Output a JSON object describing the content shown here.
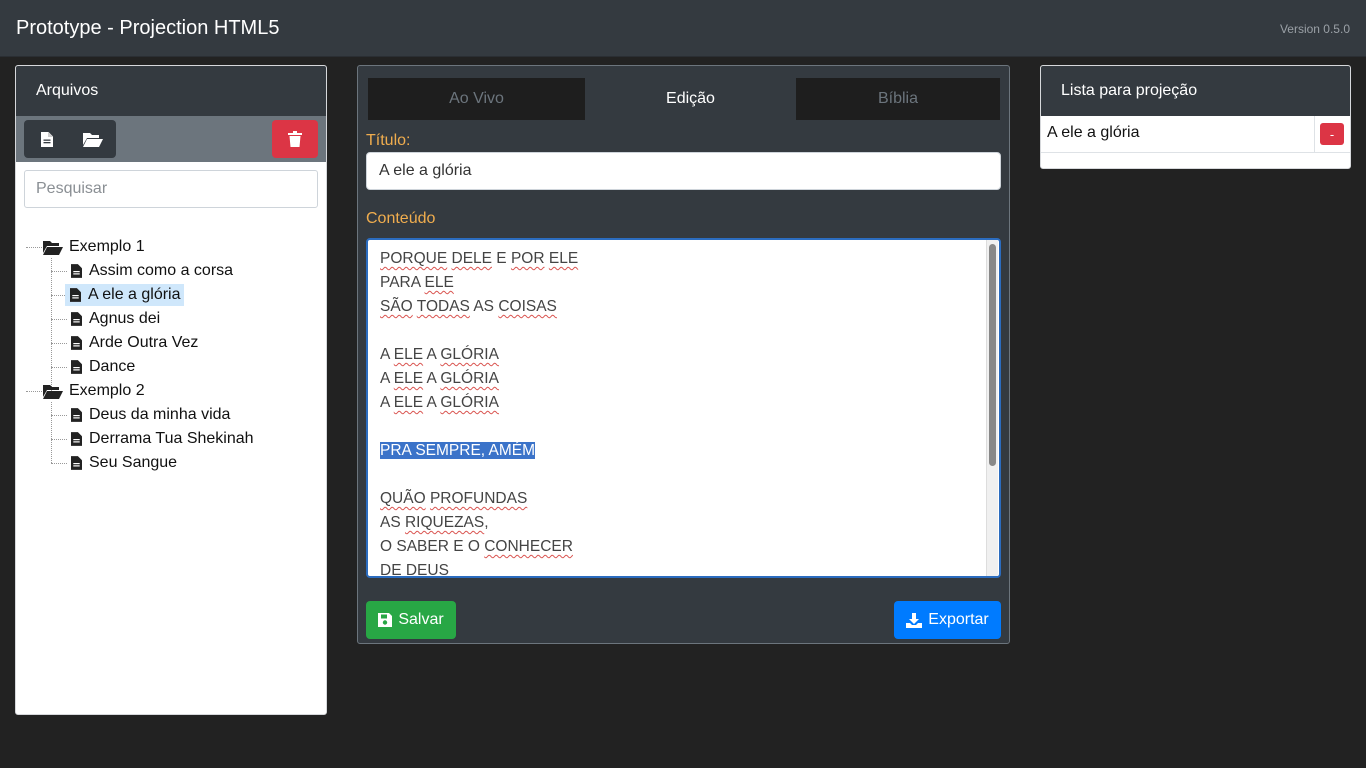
{
  "app": {
    "title": "Prototype - Projection HTML5",
    "version": "Version 0.5.0"
  },
  "files_panel": {
    "header": "Arquivos",
    "toolbar": {
      "new_icon": "file-icon",
      "open_icon": "folder-open-icon",
      "delete_icon": "trash-icon"
    },
    "search_placeholder": "Pesquisar",
    "tree": [
      {
        "label": "Exemplo 1",
        "icon": "folder-open-icon",
        "children": [
          "Assim como a corsa",
          "A ele a glória",
          "Agnus dei",
          "Arde Outra Vez",
          "Dance"
        ]
      },
      {
        "label": "Exemplo 2",
        "icon": "folder-open-icon",
        "children": [
          "Deus da minha vida",
          "Derrama Tua Shekinah",
          "Seu Sangue"
        ]
      }
    ],
    "selected_item": "A ele a glória"
  },
  "editor": {
    "tabs": [
      "Ao Vivo",
      "Edição",
      "Bíblia"
    ],
    "active_tab": "Edição",
    "title_label": "Título:",
    "title_value": "A ele a glória",
    "content_label": "Conteúdo",
    "content_lines": [
      "PORQUE DELE E POR ELE",
      "PARA ELE",
      "SÃO TODAS AS COISAS",
      "",
      "A ELE A GLÓRIA",
      "A ELE A GLÓRIA",
      "A ELE A GLÓRIA",
      "",
      "PRA SEMPRE, AMÉM",
      "",
      "QUÃO PROFUNDAS",
      "AS RIQUEZAS,",
      "O SABER E O CONHECER",
      "DE DEUS"
    ],
    "selected_line": "PRA SEMPRE, AMÉM",
    "save_label": "Salvar",
    "save_icon": "save-icon",
    "export_label": "Exportar",
    "export_icon": "download-icon"
  },
  "projection_list": {
    "header": "Lista para projeção",
    "items": [
      {
        "label": "A ele a glória",
        "remove_label": "-"
      }
    ]
  },
  "colors": {
    "accent_label": "#f0ad4e",
    "save": "#28a745",
    "export": "#007bff",
    "danger": "#dc3545",
    "dark": "#343a40",
    "selection": "#cfe7fb"
  }
}
